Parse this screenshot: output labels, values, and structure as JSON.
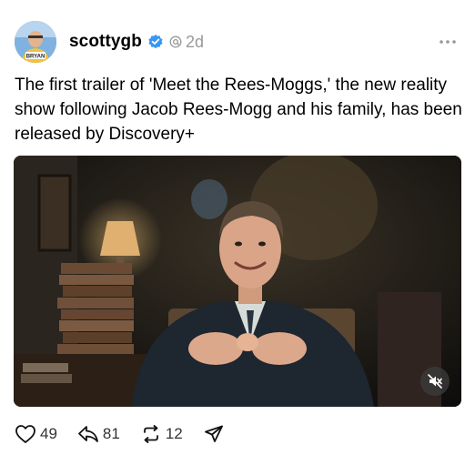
{
  "post": {
    "author": {
      "username": "scottygb",
      "avatar_badge": "BRYAN",
      "verified_icon": "verified-check-icon"
    },
    "timestamp": "2d",
    "text": "The first trailer of 'Meet the Rees-Moggs,' the new reality show following Jacob Rees-Mogg and his family, has been released by Discovery+",
    "media": {
      "type": "video",
      "muted": true
    },
    "actions": {
      "likes": "49",
      "replies": "81",
      "reposts": "12"
    }
  },
  "colors": {
    "verified": "#3897f0",
    "muted_text": "#999999",
    "text": "#000000"
  },
  "icons": [
    "more-icon",
    "heart-icon",
    "reply-icon",
    "repost-icon",
    "share-icon",
    "mute-icon",
    "threads-icon"
  ]
}
